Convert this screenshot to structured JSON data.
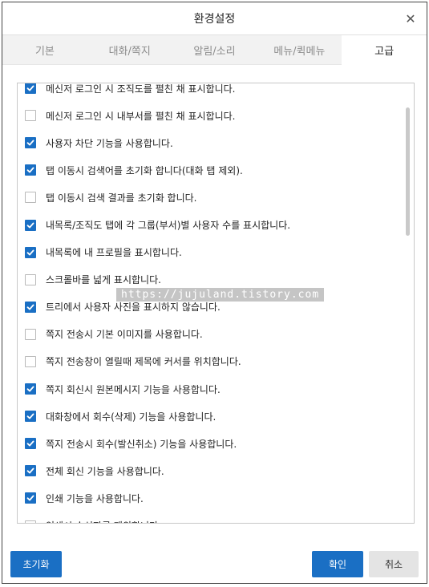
{
  "window": {
    "title": "환경설정",
    "close_symbol": "✕"
  },
  "tabs": [
    {
      "label": "기본",
      "active": false
    },
    {
      "label": "대화/쪽지",
      "active": false
    },
    {
      "label": "알림/소리",
      "active": false
    },
    {
      "label": "메뉴/퀵메뉴",
      "active": false
    },
    {
      "label": "고급",
      "active": true
    }
  ],
  "options": [
    {
      "label": "메신저 로그인 시 조직도를 펼친 채 표시합니다.",
      "checked": true
    },
    {
      "label": "메신저 로그인 시 내부서를 펼친 채 표시합니다.",
      "checked": false
    },
    {
      "label": "사용자 차단 기능을 사용합니다.",
      "checked": true
    },
    {
      "label": "탭 이동시 검색어를 초기화 합니다(대화 탭 제외).",
      "checked": true
    },
    {
      "label": "탭 이동시 검색 결과를 초기화 합니다.",
      "checked": false
    },
    {
      "label": "내목록/조직도 탭에 각 그룹(부서)별 사용자 수를 표시합니다.",
      "checked": true
    },
    {
      "label": "내목록에 내 프로필을 표시합니다.",
      "checked": true
    },
    {
      "label": "스크롤바를 넓게 표시합니다.",
      "checked": false
    },
    {
      "label": "트리에서 사용자 사진을 표시하지 않습니다.",
      "checked": true
    },
    {
      "label": "쪽지 전송시 기본 이미지를 사용합니다.",
      "checked": false
    },
    {
      "label": "쪽지 전송창이 열릴때 제목에 커서를 위치합니다.",
      "checked": false
    },
    {
      "label": "쪽지 회신시 원본메시지 기능을 사용합니다.",
      "checked": true
    },
    {
      "label": "대화창에서 회수(삭제) 기능을 사용합니다.",
      "checked": true
    },
    {
      "label": "쪽지 전송시 회수(발신취소) 기능을 사용합니다.",
      "checked": true
    },
    {
      "label": "전체 회신 기능을 사용합니다.",
      "checked": true
    },
    {
      "label": "인쇄 기능을 사용합니다.",
      "checked": true
    },
    {
      "label": "인쇄시 수신자를 제외합니다.",
      "checked": false
    }
  ],
  "watermark": "https://jujuland.tistory.com",
  "buttons": {
    "reset": "초기화",
    "ok": "확인",
    "cancel": "취소"
  },
  "colors": {
    "accent": "#1a6fc4",
    "cancel_bg": "#e4e4e4"
  }
}
